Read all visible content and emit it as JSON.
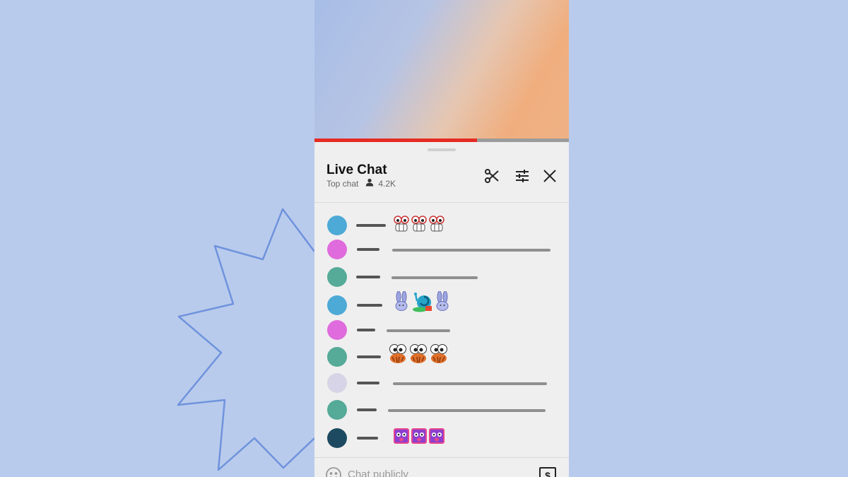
{
  "chat": {
    "title": "Live Chat",
    "mode": "Top chat",
    "viewers": "4.2K",
    "input_placeholder": "Chat publicly",
    "super_chat_symbol": "$"
  },
  "video": {
    "progress_fraction": 0.64
  },
  "icons": {
    "clip": "scissors-icon",
    "settings": "sliders-icon",
    "close": "close-icon",
    "viewers": "person-icon",
    "emoji": "smiley-icon"
  },
  "colors": {
    "avatar_blue": "#4da9d6",
    "avatar_pink": "#df6bdc",
    "avatar_teal": "#55aa98",
    "avatar_lavender": "#d6d4e6",
    "avatar_navy": "#1d4a60",
    "progress_red": "#e52b23",
    "background": "#b9cbec"
  },
  "messages": [
    {
      "avatar": "blue",
      "emoji": "googly-eyes-teeth",
      "count": 3
    },
    {
      "avatar": "pink",
      "text": "line"
    },
    {
      "avatar": "teal",
      "text": "line"
    },
    {
      "avatar": "blue",
      "emoji": "bunny-and-snail",
      "count": 3
    },
    {
      "avatar": "pink",
      "text": "line"
    },
    {
      "avatar": "teal",
      "emoji": "googly-eyes-crab",
      "count": 3
    },
    {
      "avatar": "lavender",
      "text": "line"
    },
    {
      "avatar": "teal",
      "text": "line"
    },
    {
      "avatar": "navy",
      "emoji": "purple-face",
      "count": 3
    }
  ]
}
